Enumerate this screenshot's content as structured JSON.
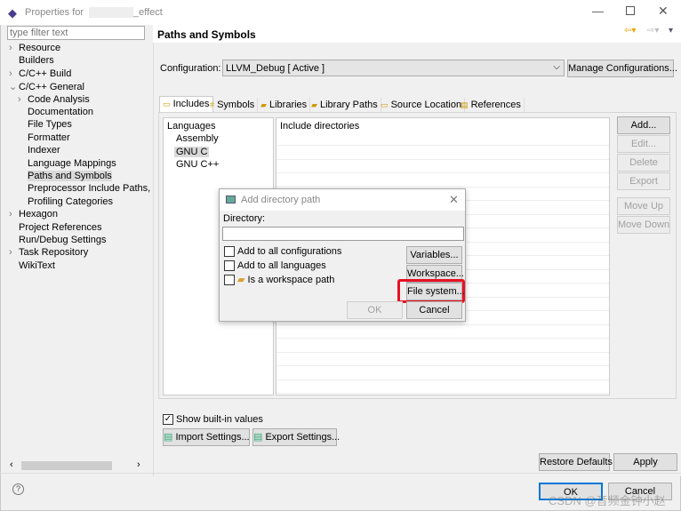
{
  "window": {
    "title": "Properties for",
    "title_suffix": "_effect"
  },
  "sidebar": {
    "filter_placeholder": "type filter text",
    "items": [
      {
        "label": "Resource",
        "arrow": "›"
      },
      {
        "label": "Builders",
        "arrow": ""
      },
      {
        "label": "C/C++ Build",
        "arrow": "›"
      },
      {
        "label": "C/C++ General",
        "arrow": "⌄"
      },
      {
        "label": "Code Analysis",
        "arrow": "›"
      },
      {
        "label": "Documentation",
        "arrow": ""
      },
      {
        "label": "File Types",
        "arrow": ""
      },
      {
        "label": "Formatter",
        "arrow": ""
      },
      {
        "label": "Indexer",
        "arrow": ""
      },
      {
        "label": "Language Mappings",
        "arrow": ""
      },
      {
        "label": "Paths and Symbols",
        "arrow": "",
        "selected": true
      },
      {
        "label": "Preprocessor Include Paths, M",
        "arrow": ""
      },
      {
        "label": "Profiling Categories",
        "arrow": ""
      },
      {
        "label": "Hexagon",
        "arrow": "›"
      },
      {
        "label": "Project References",
        "arrow": ""
      },
      {
        "label": "Run/Debug Settings",
        "arrow": ""
      },
      {
        "label": "Task Repository",
        "arrow": "›"
      },
      {
        "label": "WikiText",
        "arrow": ""
      }
    ]
  },
  "main": {
    "title": "Paths and Symbols",
    "config_label": "Configuration:",
    "config_value": "LLVM_Debug  [ Active ]",
    "manage_label": "Manage Configurations...",
    "tabs": [
      "Includes",
      "Symbols",
      "Libraries",
      "Library Paths",
      "Source Location",
      "References"
    ],
    "languages_header": "Languages",
    "languages": [
      "Assembly",
      "GNU C",
      "GNU C++"
    ],
    "include_header": "Include directories",
    "side_buttons": [
      "Add...",
      "Edit...",
      "Delete",
      "Export",
      "Move Up",
      "Move Down"
    ],
    "show_builtin": "Show built-in values",
    "import_label": "Import Settings...",
    "export_label": "Export Settings...",
    "restore_label": "Restore Defaults",
    "apply_label": "Apply"
  },
  "footer": {
    "ok": "OK",
    "cancel": "Cancel",
    "watermark": "CSDN @音频金钟小赵"
  },
  "dialog": {
    "title": "Add directory path",
    "directory_label": "Directory:",
    "directory_value": "",
    "checks": [
      "Add to all configurations",
      "Add to all languages",
      "Is a workspace path"
    ],
    "variables": "Variables...",
    "workspace": "Workspace...",
    "filesystem": "File system...",
    "ok": "OK",
    "cancel": "Cancel"
  },
  "colors": {
    "highlight": "#e81123",
    "selection": "#d9d9d9",
    "focus": "#0078d7"
  }
}
